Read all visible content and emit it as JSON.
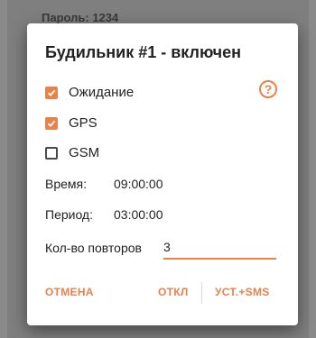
{
  "background": {
    "text": "Пароль: 1234"
  },
  "dialog": {
    "title": "Будильник #1 - включен",
    "checkboxes": [
      {
        "label": "Ожидание",
        "checked": true
      },
      {
        "label": "GPS",
        "checked": true
      },
      {
        "label": "GSM",
        "checked": false
      }
    ],
    "help_icon": "?",
    "time": {
      "label": "Время:",
      "value": "09:00:00"
    },
    "period": {
      "label": "Период:",
      "value": "03:00:00"
    },
    "repeats": {
      "label": "Кол-во повторов",
      "value": "3"
    },
    "buttons": {
      "cancel": "ОТМЕНА",
      "off": "ОТКЛ",
      "set_sms": "УСТ.+SMS"
    }
  },
  "colors": {
    "accent": "#e8824b"
  }
}
